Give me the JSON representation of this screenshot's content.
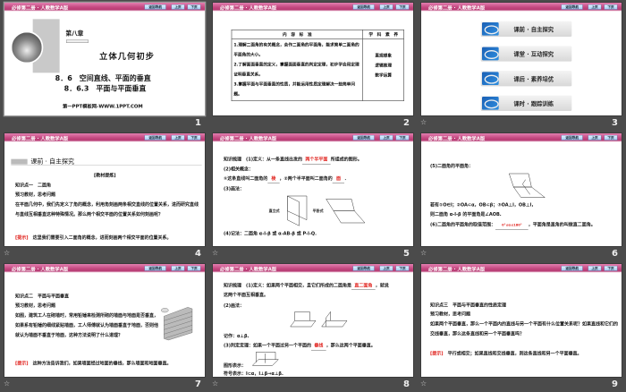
{
  "header": {
    "title": "必修第二册 · 人教数学A版",
    "back_nav": "返回导航",
    "prev": "上页",
    "next": "下页"
  },
  "slides": [
    {
      "number": "1",
      "chapter": "第八章",
      "title": "立体几何初步",
      "sub1": "8．6　空间直线、平面的垂直",
      "sub2": "8．6.3　平面与平面垂直",
      "footer": "第一PPT模板网-WWW.1PPT.COM"
    },
    {
      "number": "2",
      "col1": "内　容　标　准",
      "col2": "学　科　素　养",
      "content": "1.理解二面角的有关概念，会作二面角的平面角，能求简单二面角的平面角的大小。\n2.了解面面垂直的定义，掌握面面垂直的判定定理，初步学会用定理证明垂直关系。\n3.掌握平面与平面垂直的性质，并能运用性质定理解决一些简单问题。",
      "literacy": [
        "直观想象",
        "逻辑推理",
        "数学运算"
      ]
    },
    {
      "number": "3",
      "menu": [
        "课前 · 自主探究",
        "课堂 · 互动探究",
        "课后 · 素养培优",
        "课时 · 跟踪训练"
      ]
    },
    {
      "number": "4",
      "section": "课前 · 自主探究",
      "tag": "[教材提炼]",
      "point": "知识点一　二面角",
      "prompt": "预习教材，思考问题",
      "question": "在平面几何中，我们先定义了角的概念，利用角刻画两条相交直线的位置关系，进而研究直线与直线互相垂直这种特殊情况。那么两个相交平面的位置关系如何刻画呢？",
      "hint_label": "[提示]",
      "hint": "这里我们需要引入二面角的概念，进而刻画两个相交平面的位置关系。"
    },
    {
      "number": "5",
      "l1a": "知识梳理　(1)定义：从一条直线出发的",
      "l1b": "两个半平面",
      "l1c": "所组成的图形。",
      "l2": "(2)相关概念：",
      "l3a": "①这条直线叫二面角的",
      "l3b": "棱",
      "l3c": "，②两个半平面叫二面角的",
      "l3d": "面",
      "l4": "(3)画法：",
      "fig1": "直立式",
      "fig2": "平卧式",
      "l5": "(4)记法：二面角 α-l-β 或 α-AB-β 或 P-l-Q."
    },
    {
      "number": "6",
      "l1": "(5)二面角的平面角：",
      "l2": "若有①O∈l；②OA⊂α，OB⊂β；③OA⊥l，OB⊥l，",
      "l3": "则二面角 α-l-β 的平面角是∠AOB.",
      "l4a": "(6)二面角的平面角的取值范围：",
      "l4b": "0°≤α≤180°",
      "l4c": "，平面角是直角的叫做直二面角。"
    },
    {
      "number": "7",
      "point": "知识点二　平面与平面垂直",
      "prompt": "预习教材，思考问题",
      "question": "如图，建筑工人在砌墙时，常用铅锤来检测所砌的墙面与地面是否垂直，如果系有铅锤的细线紧贴墙面，工人师傅就认为墙面垂直于地面，否则他就认为墙面不垂直于地面，这种方法说明了什么道理？",
      "hint_label": "[提示]",
      "hint": "这种方法告诉我们，如果墙面经过地面的垂线，那么墙面和地面垂直。"
    },
    {
      "number": "8",
      "l1a": "知识梳理　(1)定义：如果两个平面相交，且它们所成的二面角是",
      "l1b": "直二面角",
      "l1c": "，就说",
      "l1d": "这两个平面互相垂直。",
      "l2": "(2)画法：",
      "l3": "记作：α⊥β.",
      "l4a": "(3)判定定理：如果一个平面过另一个平面的",
      "l4b": "垂线",
      "l4c": "，那么这两个平面垂直。",
      "l5": "图形表示：",
      "l6": "符号表示：l⊂α，l⊥β⇒α⊥β."
    },
    {
      "number": "9",
      "point": "知识点三　平面与平面垂直的性质定理",
      "prompt": "预习教材，思考问题",
      "question": "如果两个平面垂直，那么一个平面内的直线与另一个平面有什么位置关系呢？如果直线和它们的交线垂直，那么这条直线和另一个平面垂直吗？",
      "hint_label": "[提示]",
      "hint": "平行或相交；如果直线和交线垂直，则这条直线和另一个平面垂直。"
    }
  ]
}
